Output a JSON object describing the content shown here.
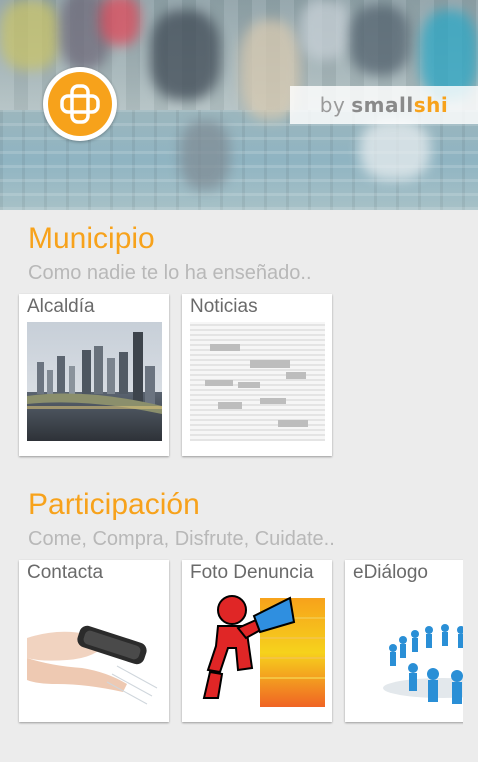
{
  "header": {
    "brand_by": "by",
    "brand_small": "small",
    "brand_shi": "shi",
    "logo_icon": "brand-cross-icon"
  },
  "sections": [
    {
      "title": "Municipio",
      "subtitle": "Como nadie te lo ha enseñado..",
      "tiles": [
        {
          "label": "Alcaldía",
          "image": "city-skyline-photo"
        },
        {
          "label": "Noticias",
          "image": "word-cloud-image"
        }
      ]
    },
    {
      "title": "Participación",
      "subtitle": "Come, Compra, Disfrute, Cuidate..",
      "tiles": [
        {
          "label": "Contacta",
          "image": "smartphone-hand-photo"
        },
        {
          "label": "Foto Denuncia",
          "image": "megaphone-figure-image"
        },
        {
          "label": "eDiálogo",
          "image": "people-circle-image"
        }
      ]
    }
  ],
  "colors": {
    "accent": "#f7a21b",
    "background": "#ececec",
    "subtitle": "#b8b8b8",
    "tile_label": "#6a6a6a"
  }
}
